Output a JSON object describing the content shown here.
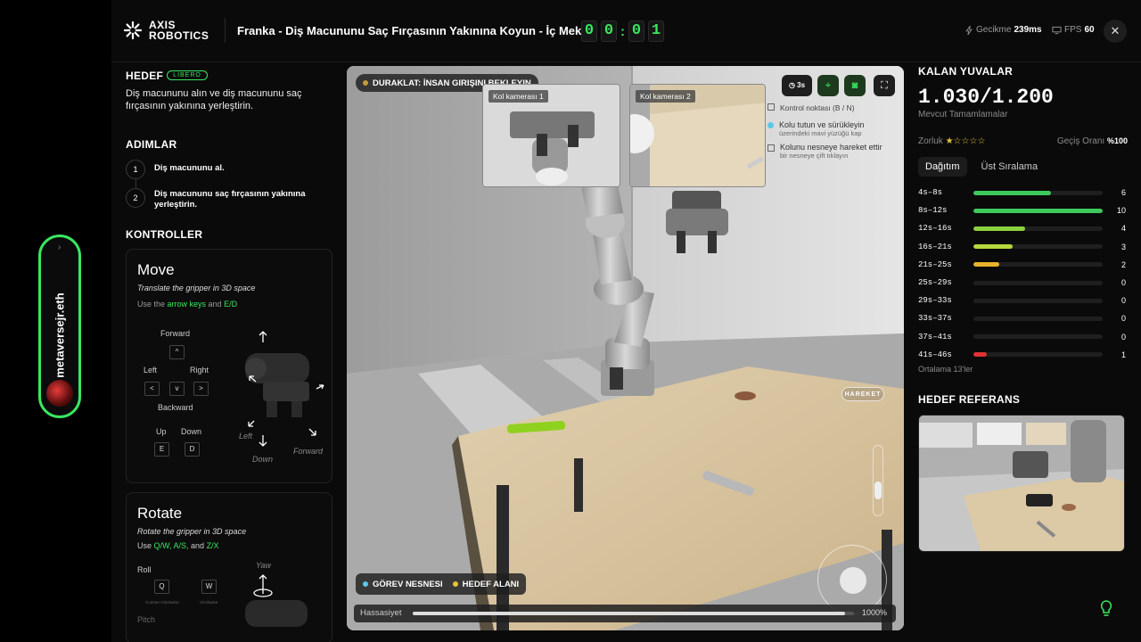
{
  "header": {
    "logo_line1": "AXIS",
    "logo_line2": "ROBOTICS",
    "title": "Franka - Diş Macununu Saç Fırçasının Yakınına Koyun - İç Mekan",
    "timer_digits": [
      "0",
      "0",
      "0",
      "1"
    ],
    "latency_label": "Gecikme",
    "latency_value": "239ms",
    "fps_label": "FPS",
    "fps_value": "60",
    "close_label": "✕"
  },
  "handle": {
    "username": "metaversejr.eth",
    "arrow": "›"
  },
  "left": {
    "goal_title": "HEDEF",
    "goal_badge": "LIBERO",
    "goal_text": "Diş macununu alın ve diş macununu saç fırçasının yakınına yerleştirin.",
    "steps_title": "ADIMLAR",
    "steps": [
      {
        "num": "1",
        "text": "Diş macununu al."
      },
      {
        "num": "2",
        "text": "Diş macununu saç fırçasının yakınına yerleştirin."
      }
    ],
    "controls_title": "KONTROLLER",
    "move": {
      "title": "Move",
      "sub": "Translate the gripper in 3D space",
      "hint_pre": "Use the ",
      "hint_keys": "arrow keys",
      "hint_mid": " and ",
      "hint_keys2": "E/D",
      "forward": "Forward",
      "left": "Left",
      "right": "Right",
      "backward": "Backward",
      "up": "Up",
      "down": "Down",
      "key_up": "^",
      "key_left": "<",
      "key_down": "v",
      "key_right": ">",
      "key_e": "E",
      "key_d": "D",
      "diag_left": "Left",
      "diag_down": "Down",
      "diag_forward": "Forward"
    },
    "rotate": {
      "title": "Rotate",
      "sub": "Rotate the gripper in 3D space",
      "hint_pre": "Use ",
      "hint_keys": "Q/W, A/S,",
      "hint_mid": " and ",
      "hint_keys2": "Z/X",
      "roll": "Roll",
      "key_q": "Q",
      "key_w": "W",
      "counter": "Counter-Clockwise",
      "clockwise": "Clockwise",
      "yaw": "Yaw",
      "pitch": "Pitch"
    }
  },
  "viewport": {
    "status": "DURAKLAT: İNSAN GIRIŞINI BEKLEYIN",
    "cam1": "Kol kamerası 1",
    "cam2": "Kol kamerası 2",
    "timer_btn": "3s",
    "legend1": "Kontrol noktası (B / N)",
    "legend2": "Kolu tutun ve sürükleyin",
    "legend2_small": "üzerindeki mavi yüzüğü kap",
    "legend3": "Kolunu nesneye hareket ettir",
    "legend3_small": "bir nesneye çift tıklayın",
    "hareket": "HAREKET",
    "task_object": "GÖREV NESNESI",
    "target_area": "HEDEF ALANI",
    "sensitivity_label": "Hassasiyet",
    "sensitivity_value": "1000%",
    "sensitivity_fill": 0.98
  },
  "right": {
    "title": "KALAN YUVALAR",
    "slots": "1.030/1.200",
    "slots_sub": "Mevcut Tamamlamalar",
    "difficulty_label": "Zorluk",
    "difficulty_stars": 1,
    "pass_label": "Geçiş Oranı",
    "pass_value": "%100",
    "tab1": "Dağıtım",
    "tab2": "Üst Sıralama",
    "average": "Ortalama 13'ler",
    "ref_title": "HEDEF REFERANS"
  },
  "chart_data": {
    "type": "bar",
    "categories": [
      "4s–8s",
      "8s–12s",
      "12s–16s",
      "16s–21s",
      "21s–25s",
      "25s–29s",
      "29s–33s",
      "33s–37s",
      "37s–41s",
      "41s–46s"
    ],
    "values": [
      6,
      10,
      4,
      3,
      2,
      0,
      0,
      0,
      0,
      1
    ],
    "colors": [
      "#3ec95c",
      "#3ec95c",
      "#8bd13f",
      "#b6d83a",
      "#e8b32c",
      "#333",
      "#333",
      "#333",
      "#333",
      "#e03232"
    ]
  }
}
